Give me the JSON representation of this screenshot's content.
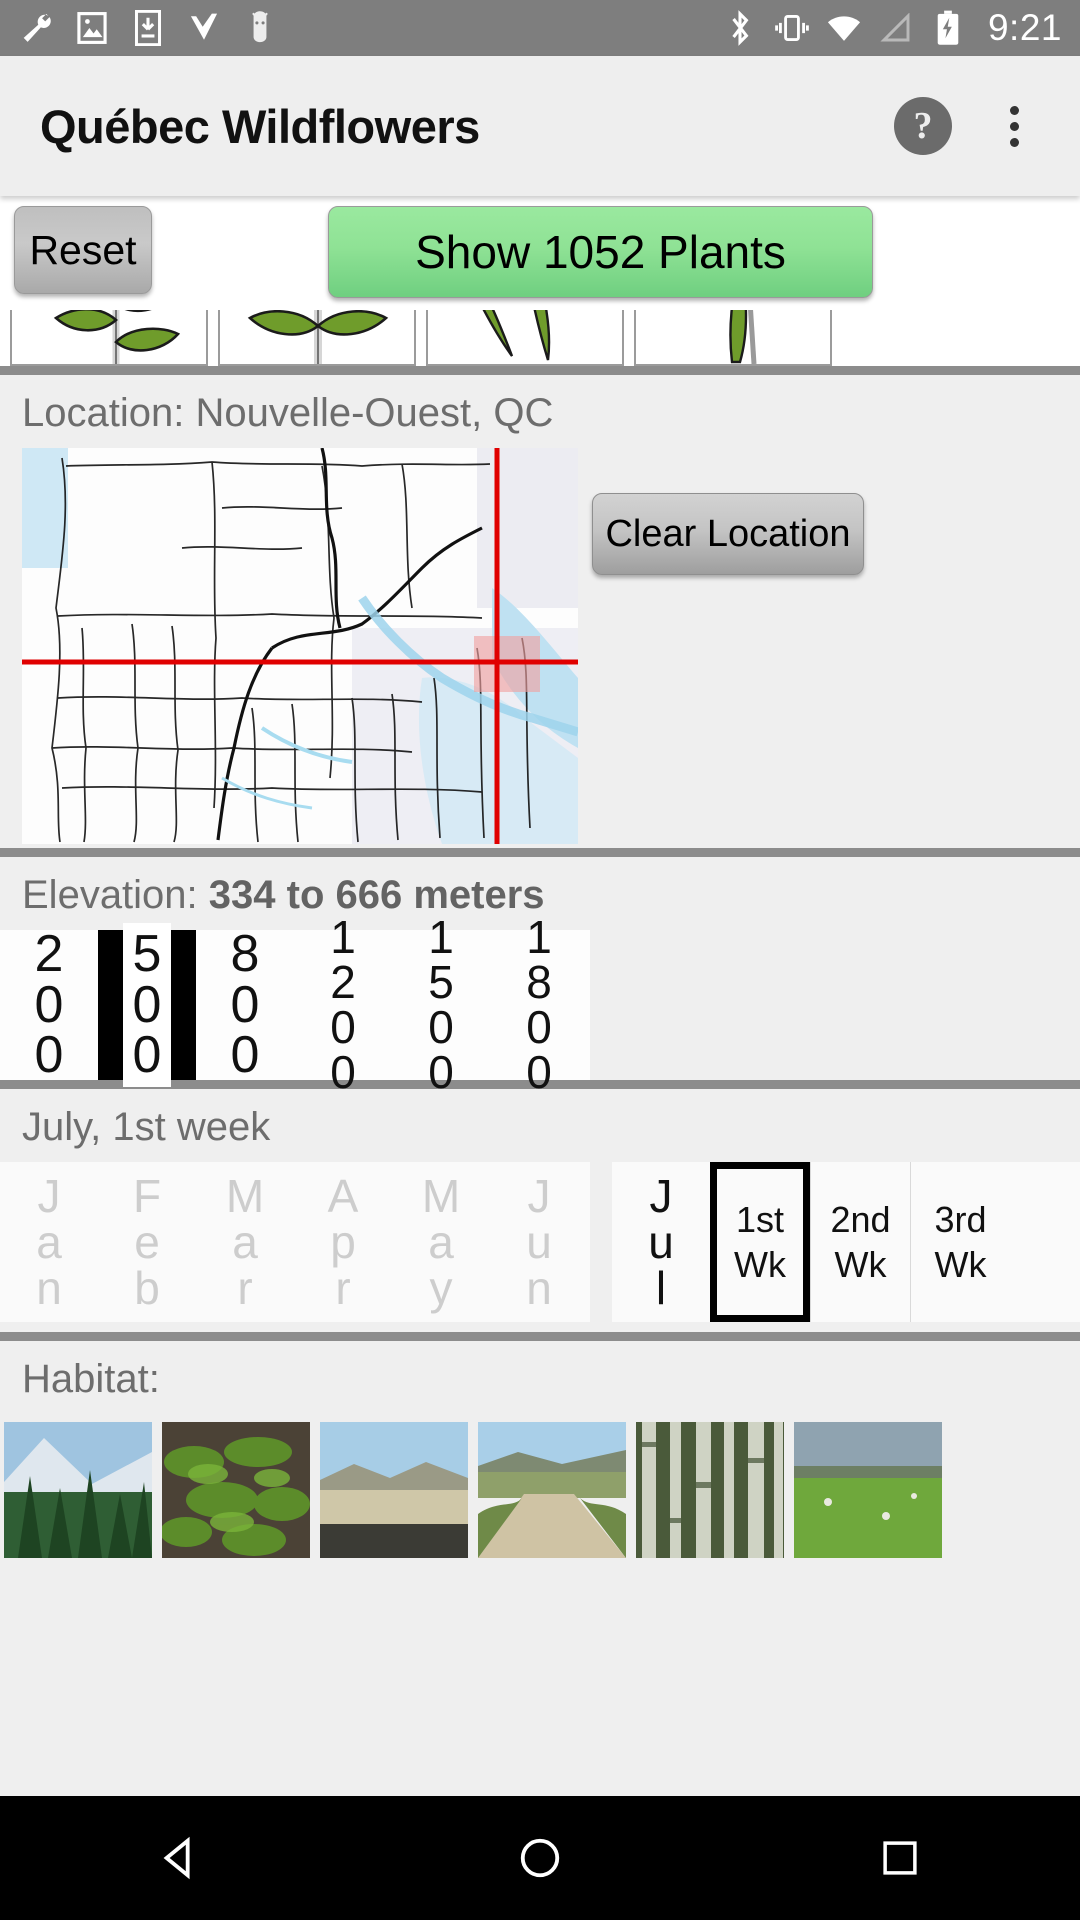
{
  "status_bar": {
    "time": "9:21",
    "left_icons": [
      "wrench-icon",
      "image-icon",
      "download-icon",
      "checkmark-icon",
      "android-icon"
    ],
    "right_icons": [
      "bluetooth-icon",
      "vibrate-icon",
      "wifi-icon",
      "signal-icon",
      "battery-charging-icon"
    ]
  },
  "app_bar": {
    "title": "Québec Wildflowers",
    "help_glyph": "?",
    "overflow_name": "more-options"
  },
  "filter_buttons": {
    "reset_label": "Reset",
    "show_label": "Show 1052 Plants",
    "plant_count": 1052,
    "show_color": "#8fe295",
    "reset_color": "#c4c4c4"
  },
  "leaf_arrangements": [
    {
      "name": "leaf-alternate"
    },
    {
      "name": "leaf-opposite"
    },
    {
      "name": "leaf-whorled"
    },
    {
      "name": "leaf-basal"
    }
  ],
  "location": {
    "label": "Location: Nouvelle-Ouest, QC",
    "clear_label": "Clear Location",
    "crosshair_color": "#e00000"
  },
  "elevation": {
    "label_prefix": "Elevation: ",
    "label_value": "334 to 666 meters",
    "min": 334,
    "max": 666,
    "units": "meters",
    "options": [
      "200",
      "500",
      "800",
      "1200",
      "1500",
      "1800"
    ],
    "selected": "500",
    "selected_index": 1
  },
  "bloom_time": {
    "label": "July, 1st week",
    "months": [
      "Jan",
      "Feb",
      "Mar",
      "Apr",
      "May",
      "Jun"
    ],
    "selected_month": "Jul",
    "weeks": [
      "1st Wk",
      "2nd Wk"
    ],
    "selected_week": "1st Wk",
    "selected_week_index": 0
  },
  "habitat": {
    "label": "Habitat:",
    "items": [
      {
        "name": "habitat-alpine-conifer"
      },
      {
        "name": "habitat-fern-rock"
      },
      {
        "name": "habitat-desert-basin"
      },
      {
        "name": "habitat-roadside-sage"
      },
      {
        "name": "habitat-forest-trunks"
      },
      {
        "name": "habitat-pasture-field"
      }
    ]
  },
  "nav_bar": {
    "back": "back-triangle-icon",
    "home": "home-circle-icon",
    "recents": "recents-square-icon"
  }
}
